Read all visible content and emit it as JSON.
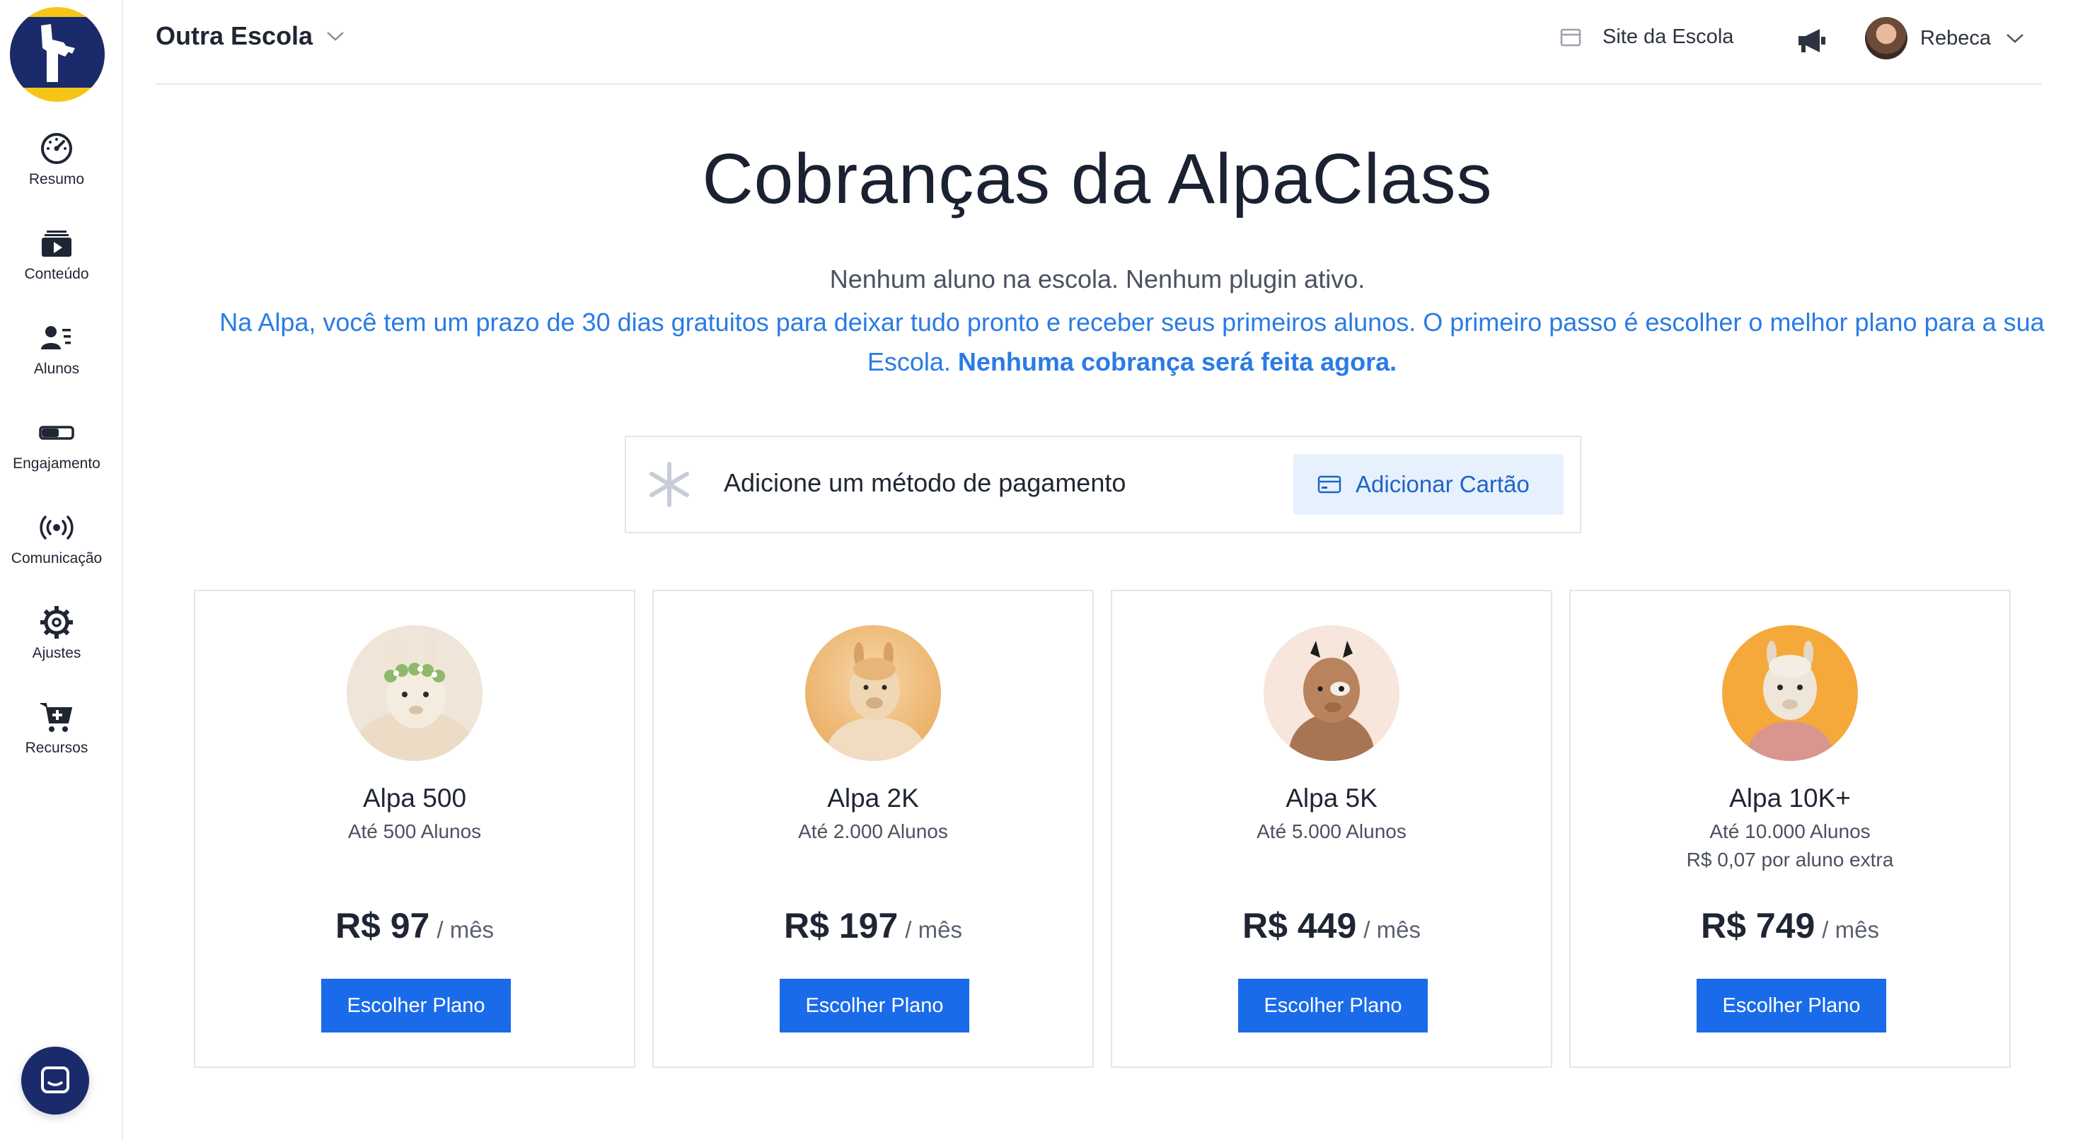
{
  "sidebar": {
    "items": [
      {
        "label": "Resumo",
        "icon": "gauge-icon"
      },
      {
        "label": "Conteúdo",
        "icon": "video-library-icon"
      },
      {
        "label": "Alunos",
        "icon": "students-icon"
      },
      {
        "label": "Engajamento",
        "icon": "toggle-icon"
      },
      {
        "label": "Comunicação",
        "icon": "broadcast-icon"
      },
      {
        "label": "Ajustes",
        "icon": "gear-icon"
      },
      {
        "label": "Recursos",
        "icon": "cart-plus-icon"
      }
    ]
  },
  "header": {
    "school_name": "Outra Escola",
    "site_link": "Site da Escola",
    "user_name": "Rebeca"
  },
  "main": {
    "title": "Cobranças da AlpaClass",
    "status": "Nenhum aluno na escola. Nenhum plugin ativo.",
    "intro": "Na Alpa, você tem um prazo de 30 dias gratuitos para deixar tudo pronto e receber seus primeiros alunos. O primeiro passo é escolher o melhor plano para a sua Escola.",
    "intro_bold": "Nenhuma cobrança será feita agora.",
    "payment": {
      "prompt": "Adicione um método de pagamento",
      "button": "Adicionar Cartão"
    },
    "plans": [
      {
        "name": "Alpa 500",
        "desc": "Até 500 Alunos",
        "extra": "",
        "price": "R$ 97",
        "period": "/ mês",
        "button": "Escolher Plano"
      },
      {
        "name": "Alpa 2K",
        "desc": "Até 2.000 Alunos",
        "extra": "",
        "price": "R$ 197",
        "period": "/ mês",
        "button": "Escolher Plano"
      },
      {
        "name": "Alpa 5K",
        "desc": "Até 5.000 Alunos",
        "extra": "",
        "price": "R$ 449",
        "period": "/ mês",
        "button": "Escolher Plano"
      },
      {
        "name": "Alpa 10K+",
        "desc": "Até 10.000 Alunos",
        "extra": "R$ 0,07 por aluno extra",
        "price": "R$ 749",
        "period": "/ mês",
        "button": "Escolher Plano"
      }
    ]
  },
  "colors": {
    "brand_navy": "#1b2a6b",
    "brand_yellow": "#f5c518",
    "primary_button": "#1a6bea",
    "info_text": "#2a7be4"
  }
}
